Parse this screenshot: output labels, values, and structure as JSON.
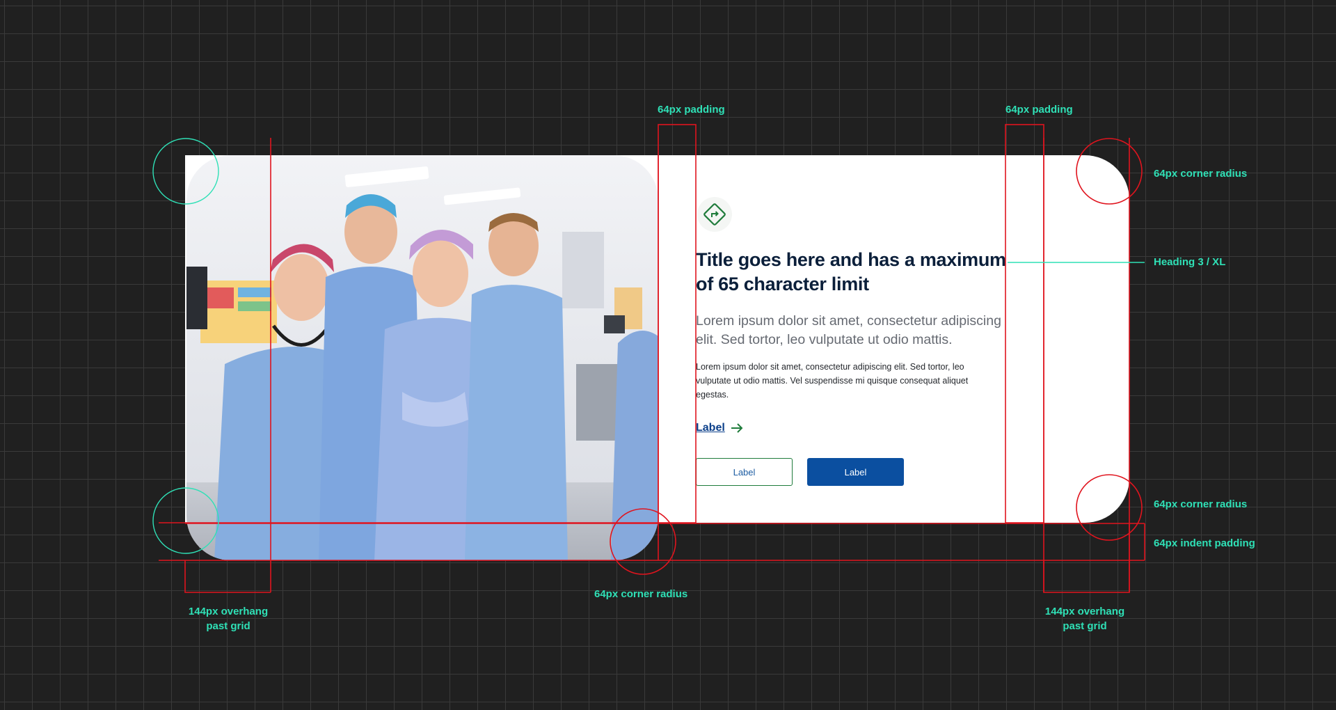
{
  "card": {
    "icon": "arrow-turn-icon",
    "title": "Title goes here and has a maximum of 65 character limit",
    "lead": "Lorem ipsum dolor sit amet, consectetur adipiscing elit. Sed tortor, leo vulputate ut odio mattis.",
    "body": "Lorem ipsum dolor sit amet, consectetur adipiscing elit. Sed tortor, leo vulputate ut odio mattis. Vel suspendisse mi quisque consequat aliquet egestas.",
    "link_label": "Label",
    "button_secondary": "Label",
    "button_primary": "Label"
  },
  "annotations": {
    "padding_left": "64px padding",
    "padding_right": "64px padding",
    "corner_radius_top": "64px corner radius",
    "heading_style": "Heading 3 / XL",
    "corner_radius_bottom_right": "64px corner radius",
    "indent_padding": "64px indent padding",
    "corner_radius_image": "64px corner radius",
    "overhang_left_1": "144px overhang",
    "overhang_left_2": "past grid",
    "overhang_right_1": "144px overhang",
    "overhang_right_2": "past grid"
  },
  "colors": {
    "background": "#202020",
    "annotation": "#2fe0b6",
    "guide_red": "#e0141e",
    "title": "#0b1f3a",
    "primary_button": "#0b4fa0",
    "accent_green": "#1e7b3a"
  }
}
